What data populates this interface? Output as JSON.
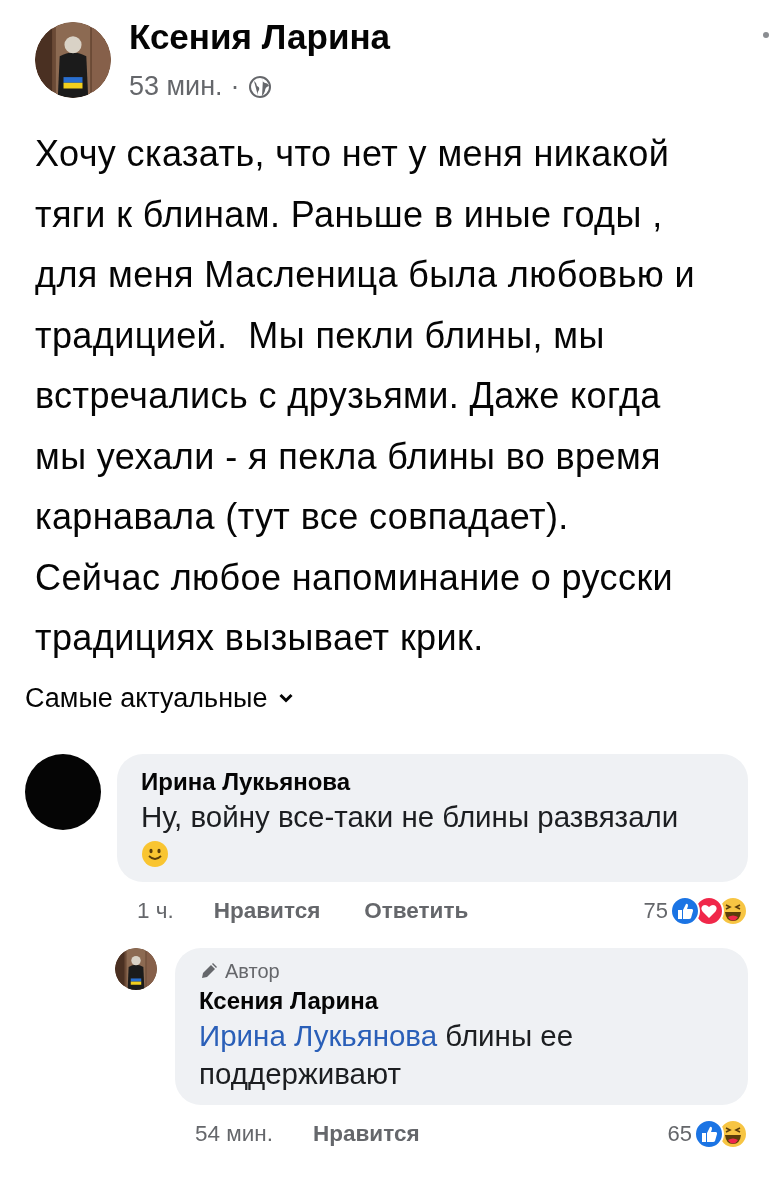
{
  "post": {
    "author": "Ксения Ларина",
    "time": "53 мин.",
    "separator": "·",
    "audience": {
      "kind": "public"
    },
    "avatar": {
      "kind": "picture"
    },
    "text": "Хочу сказать, что нет у меня никакой\nтяги к блинам. Раньше в иные годы ,\nдля меня Масленица была любовью и\nтрадицией.  Мы пекли блины, мы\nвстречались с друзьями. Даже когда\nмы уехали - я пекла блины во время\nкарнавала (тут все совпадает).\nСейчас любое напоминание о русски\nтрадициях вызывает крик."
  },
  "sort": {
    "label": "Самые актуальные"
  },
  "comments": [
    {
      "kind": "comment",
      "avatar": {
        "kind": "blank"
      },
      "author": "Ирина Лукьянова",
      "text": "Ну, войну все-таки не блины развязали",
      "emoji": {
        "kind": "smile"
      },
      "time": "1 ч.",
      "actions": [
        "Нравится",
        "Ответить"
      ],
      "reaction_count": "75",
      "reactions": [
        {
          "kind": "like"
        },
        {
          "kind": "love"
        },
        {
          "kind": "haha"
        }
      ]
    },
    {
      "kind": "reply",
      "avatar": {
        "kind": "picture"
      },
      "badge": "Автор",
      "author": "Ксения Ларина",
      "mention": "Ирина Лукьянова",
      "text": "блины ее\nподдерживают",
      "time": "54 мин.",
      "actions": [
        "Нравится"
      ],
      "reaction_count": "65",
      "reactions": [
        {
          "kind": "like"
        },
        {
          "kind": "haha"
        }
      ]
    }
  ]
}
